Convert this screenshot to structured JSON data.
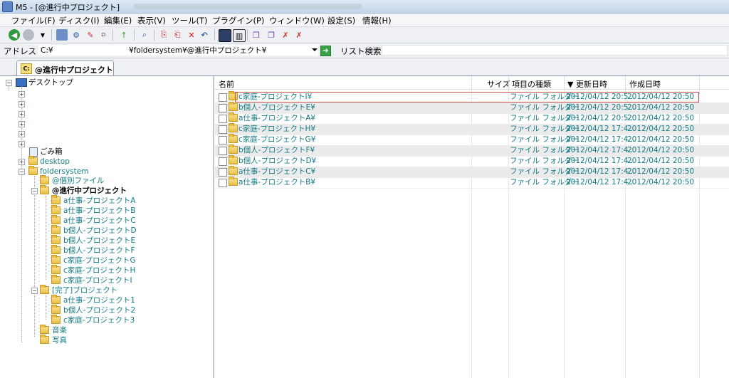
{
  "window": {
    "title": "M5 - [@進行中プロジェクト]"
  },
  "menu": [
    "ファイル(F)",
    "ディスク(I)",
    "編集(E)",
    "表示(V)",
    "ツール(T)",
    "プラグイン(P)",
    "ウィンドウ(W)",
    "設定(S)",
    "情報(H)"
  ],
  "address": {
    "label": "アドレス",
    "drive": "C:¥",
    "path": "¥foldersystem¥@進行中プロジェクト¥"
  },
  "search": {
    "label": "リスト検索",
    "value": ""
  },
  "tab": {
    "icon_text": "C:",
    "label": "@進行中プロジェクト"
  },
  "tree": {
    "root": "デスクトップ",
    "items": {
      "recycle": "ごみ箱",
      "desktop": "desktop",
      "foldersystem": "foldersystem",
      "kobetsu": "@個別ファイル",
      "active": "@進行中プロジェクト",
      "a1": "a仕事-プロジェクトA",
      "a2": "a仕事-プロジェクトB",
      "a3": "a仕事-プロジェクトC",
      "b1": "b個人-プロジェクトD",
      "b2": "b個人-プロジェクトE",
      "b3": "b個人-プロジェクトF",
      "c1": "c家庭-プロジェクトG",
      "c2": "c家庭-プロジェクトH",
      "c3": "c家庭-プロジェクトI",
      "done": "[完了]プロジェクト",
      "d1": "a仕事-プロジェクト1",
      "d2": "b個人-プロジェクト2",
      "d3": "c家庭-プロジェクト3",
      "music": "音楽",
      "photo": "写真"
    }
  },
  "list": {
    "columns": {
      "name": "名前",
      "size": "サイズ",
      "type": "項目の種類",
      "modified": "▼ 更新日時",
      "created": "作成日時"
    },
    "rows": [
      {
        "name": "c家庭-プロジェクトI¥",
        "size": "",
        "type": "ファイル フォルダー",
        "modified": "2012/04/12 20:5...",
        "created": "2012/04/12 20:50"
      },
      {
        "name": "b個人-プロジェクトE¥",
        "size": "",
        "type": "ファイル フォルダー",
        "modified": "2012/04/12 20:5...",
        "created": "2012/04/12 20:50"
      },
      {
        "name": "a仕事-プロジェクトA¥",
        "size": "",
        "type": "ファイル フォルダー",
        "modified": "2012/04/12 20:5...",
        "created": "2012/04/12 20:50"
      },
      {
        "name": "c家庭-プロジェクトH¥",
        "size": "",
        "type": "ファイル フォルダー",
        "modified": "2012/04/12 17:4...",
        "created": "2012/04/12 20:50"
      },
      {
        "name": "c家庭-プロジェクトG¥",
        "size": "",
        "type": "ファイル フォルダー",
        "modified": "2012/04/12 17:4...",
        "created": "2012/04/12 20:50"
      },
      {
        "name": "b個人-プロジェクトF¥",
        "size": "",
        "type": "ファイル フォルダー",
        "modified": "2012/04/12 17:4...",
        "created": "2012/04/12 20:50"
      },
      {
        "name": "b個人-プロジェクトD¥",
        "size": "",
        "type": "ファイル フォルダー",
        "modified": "2012/04/12 17:4...",
        "created": "2012/04/12 20:50"
      },
      {
        "name": "a仕事-プロジェクトC¥",
        "size": "",
        "type": "ファイル フォルダー",
        "modified": "2012/04/12 17:4...",
        "created": "2012/04/12 20:50"
      },
      {
        "name": "a仕事-プロジェクトB¥",
        "size": "",
        "type": "ファイル フォルダー",
        "modified": "2012/04/12 17:4...",
        "created": "2012/04/12 20:50"
      }
    ]
  },
  "colors": {
    "teal_text": "#127a84",
    "selection_outline": "#c9514b",
    "alt_row": "#ebebeb"
  }
}
